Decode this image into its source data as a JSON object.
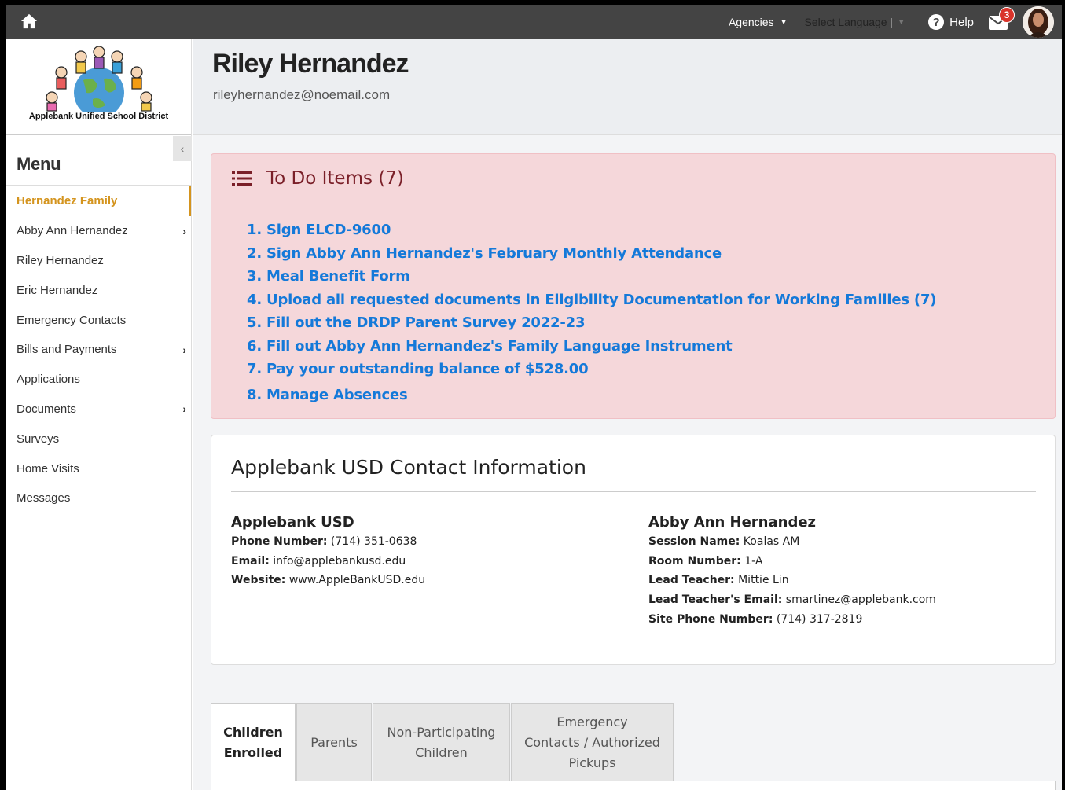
{
  "topbar": {
    "agencies_label": "Agencies",
    "language_label": "Select Language",
    "help_label": "Help",
    "mail_count": "3"
  },
  "sidebar": {
    "logo_text": "Applebank Unified School District",
    "menu_title": "Menu",
    "collapse_glyph": "‹",
    "items": [
      {
        "label": "Hernandez Family",
        "active": true,
        "has_children": false
      },
      {
        "label": "Abby Ann Hernandez",
        "has_children": true
      },
      {
        "label": "Riley Hernandez",
        "has_children": false
      },
      {
        "label": "Eric Hernandez",
        "has_children": false
      },
      {
        "label": "Emergency Contacts",
        "has_children": false
      },
      {
        "label": "Bills and Payments",
        "has_children": true
      },
      {
        "label": "Applications",
        "has_children": false
      },
      {
        "label": "Documents",
        "has_children": true
      },
      {
        "label": "Surveys",
        "has_children": false
      },
      {
        "label": "Home Visits",
        "has_children": false
      },
      {
        "label": "Messages",
        "has_children": false
      }
    ]
  },
  "header": {
    "name": "Riley Hernandez",
    "email": "rileyhernandez@noemail.com"
  },
  "todo": {
    "title": "To Do Items (7)",
    "items": [
      "1. Sign ELCD-9600",
      "2. Sign Abby Ann Hernandez's February Monthly Attendance",
      "3. Meal Benefit Form",
      "4. Upload all requested documents in Eligibility Documentation for Working Families (7)",
      "5. Fill out the DRDP Parent Survey 2022-23",
      "6. Fill out Abby Ann Hernandez's Family Language Instrument",
      "7. Pay your outstanding balance of $528.00",
      "8. Manage Absences"
    ]
  },
  "contact": {
    "title": "Applebank USD Contact Information",
    "agency": {
      "name": "Applebank USD",
      "rows": [
        {
          "label": "Phone Number:",
          "value": " (714) 351-0638"
        },
        {
          "label": "Email:",
          "value": " info@applebankusd.edu"
        },
        {
          "label": "Website:",
          "value": " www.AppleBankUSD.edu"
        }
      ]
    },
    "child": {
      "name": "Abby Ann Hernandez",
      "rows": [
        {
          "label": "Session Name:",
          "value": " Koalas AM"
        },
        {
          "label": "Room Number:",
          "value": " 1-A"
        },
        {
          "label": "Lead Teacher:",
          "value": " Mittie Lin"
        },
        {
          "label": "Lead Teacher's Email:",
          "value": " smartinez@applebank.com"
        },
        {
          "label": "Site Phone Number:",
          "value": " (714) 317-2819"
        }
      ]
    }
  },
  "tabs": [
    {
      "line1": "Children",
      "line2": "Enrolled",
      "line3": "",
      "active": true
    },
    {
      "line1": "Parents",
      "line2": "",
      "line3": ""
    },
    {
      "line1": "Non-Participating",
      "line2": "Children",
      "line3": ""
    },
    {
      "line1": "Emergency",
      "line2": "Contacts / Authorized",
      "line3": "Pickups"
    }
  ],
  "colors": {
    "accent": "#d4941e",
    "link": "#1479d9",
    "todo_bg": "#f5d7da",
    "todo_title": "#7a1f28",
    "topbar": "#444444",
    "badge": "#d9342b"
  }
}
